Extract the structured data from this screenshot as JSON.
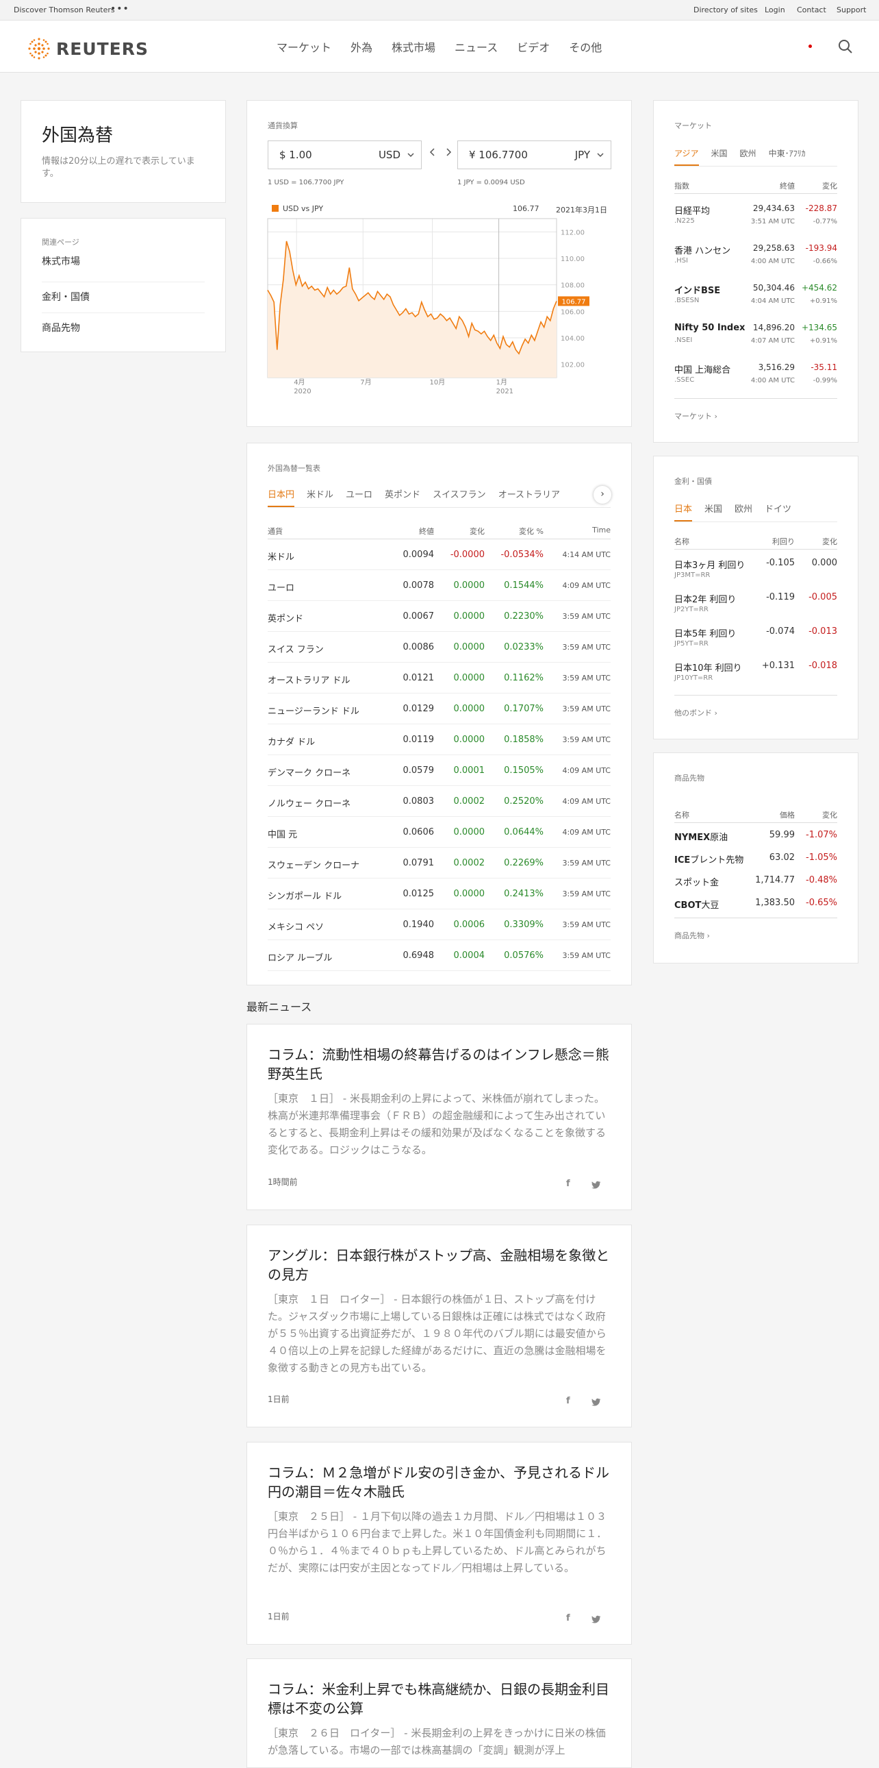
{
  "topbar": {
    "discover": "Discover Thomson Reuters",
    "links": [
      "Directory of sites",
      "Login",
      "Contact",
      "Support"
    ]
  },
  "header": {
    "logo": "REUTERS",
    "nav": [
      "マーケット",
      "外為",
      "株式市場",
      "ニュース",
      "ビデオ",
      "その他"
    ]
  },
  "page": {
    "title": "外国為替",
    "note": "情報は20分以上の遅れで表示しています。"
  },
  "related": {
    "heading": "関連ページ",
    "items": [
      "株式市場",
      "金利・国債",
      "商品先物"
    ]
  },
  "converter": {
    "heading": "通貨換算",
    "from_value": "$ 1.00",
    "from_ccy": "USD",
    "to_value": "¥ 106.7700",
    "to_ccy": "JPY",
    "rate1": "1 USD = 106.7700 JPY",
    "rate2": "1 JPY = 0.0094 USD"
  },
  "chart_data": {
    "type": "line",
    "legend": "USD vs JPY",
    "last_value": "106.77",
    "last_date": "2021年3月1日",
    "badge": "106.77",
    "yticks": [
      "112.00",
      "110.00",
      "108.00",
      "106.00",
      "104.00",
      "102.00"
    ],
    "xticks": [
      {
        "m": "4月",
        "y": "2020"
      },
      {
        "m": "7月",
        "y": ""
      },
      {
        "m": "10月",
        "y": ""
      },
      {
        "m": "1月",
        "y": "2021"
      }
    ],
    "ylim": [
      101,
      113
    ],
    "values": [
      107.6,
      107.2,
      106.7,
      103.1,
      106.5,
      108.4,
      111.3,
      110.5,
      109.1,
      108.0,
      108.7,
      107.9,
      108.2,
      107.7,
      107.9,
      107.6,
      107.7,
      107.4,
      107.1,
      107.8,
      107.3,
      107.6,
      107.3,
      107.5,
      107.8,
      107.9,
      109.3,
      107.7,
      107.3,
      106.8,
      107.0,
      107.2,
      107.4,
      107.1,
      106.9,
      107.5,
      107.2,
      106.9,
      107.3,
      107.1,
      106.5,
      106.1,
      105.7,
      105.9,
      106.2,
      105.8,
      105.9,
      105.6,
      105.8,
      106.7,
      106.1,
      105.6,
      105.8,
      105.4,
      105.5,
      105.8,
      105.6,
      105.3,
      105.5,
      105.1,
      104.7,
      105.6,
      105.3,
      104.8,
      104.1,
      105.1,
      104.6,
      104.5,
      104.3,
      104.5,
      104.1,
      103.8,
      104.2,
      103.6,
      103.2,
      104.1,
      103.5,
      103.3,
      103.7,
      103.1,
      102.8,
      103.4,
      103.9,
      103.6,
      104.2,
      103.8,
      104.5,
      105.2,
      104.8,
      105.6,
      105.3,
      106.2,
      106.77
    ]
  },
  "fx": {
    "heading": "外国為替一覧表",
    "tabs": [
      "日本円",
      "米ドル",
      "ユーロ",
      "英ポンド",
      "スイスフラン",
      "オーストラリア"
    ],
    "cols": [
      "通貨",
      "終値",
      "変化",
      "変化 %",
      "Time"
    ],
    "rows": [
      [
        "米ドル",
        "0.0094",
        "-0.0000",
        "-0.0534%",
        "4:14 AM UTC"
      ],
      [
        "ユーロ",
        "0.0078",
        "0.0000",
        "0.1544%",
        "4:09 AM UTC"
      ],
      [
        "英ポンド",
        "0.0067",
        "0.0000",
        "0.2230%",
        "3:59 AM UTC"
      ],
      [
        "スイス フラン",
        "0.0086",
        "0.0000",
        "0.0233%",
        "3:59 AM UTC"
      ],
      [
        "オーストラリア ドル",
        "0.0121",
        "0.0000",
        "0.1162%",
        "3:59 AM UTC"
      ],
      [
        "ニュージーランド ドル",
        "0.0129",
        "0.0000",
        "0.1707%",
        "3:59 AM UTC"
      ],
      [
        "カナダ ドル",
        "0.0119",
        "0.0000",
        "0.1858%",
        "3:59 AM UTC"
      ],
      [
        "デンマーク クローネ",
        "0.0579",
        "0.0001",
        "0.1505%",
        "4:09 AM UTC"
      ],
      [
        "ノルウェー クローネ",
        "0.0803",
        "0.0002",
        "0.2520%",
        "4:09 AM UTC"
      ],
      [
        "中国 元",
        "0.0606",
        "0.0000",
        "0.0644%",
        "4:09 AM UTC"
      ],
      [
        "スウェーデン クローナ",
        "0.0791",
        "0.0002",
        "0.2269%",
        "3:59 AM UTC"
      ],
      [
        "シンガポール ドル",
        "0.0125",
        "0.0000",
        "0.2413%",
        "3:59 AM UTC"
      ],
      [
        "メキシコ ペソ",
        "0.1940",
        "0.0006",
        "0.3309%",
        "3:59 AM UTC"
      ],
      [
        "ロシア ルーブル",
        "0.6948",
        "0.0004",
        "0.0576%",
        "3:59 AM UTC"
      ]
    ]
  },
  "newsHeading": "最新ニュース",
  "news": [
    {
      "title": "コラム：流動性相場の終幕告げるのはインフレ懸念＝熊野英生氏",
      "body": "［東京　１日］ - 米長期金利の上昇によって、米株価が崩れてしまった。株高が米連邦準備理事会（ＦＲＢ）の超金融緩和によって生み出されているとすると、長期金利上昇はその緩和効果が及ばなくなることを象徴する変化である。ロジックはこうなる。",
      "time": "1時間前"
    },
    {
      "title": "アングル：日本銀行株がストップ高、金融相場を象徴との見方",
      "body": "［東京　１日　ロイター］ - 日本銀行の株価が１日、ストップ高を付けた。ジャスダック市場に上場している日銀株は正確には株式ではなく政府が５５％出資する出資証券だが、１９８０年代のバブル期には最安値から４０倍以上の上昇を記録した経緯があるだけに、直近の急騰は金融相場を象徴する動きとの見方も出ている。",
      "time": "1日前"
    },
    {
      "title": "コラム：Ｍ２急増がドル安の引き金か、予見されるドル円の潮目＝佐々木融氏",
      "body": "［東京　２５日］ - １月下旬以降の過去１カ月間、ドル／円相場は１０３円台半ばから１０６円台まで上昇した。米１０年国債金利も同期間に１．０％から１．４％まで４０ｂｐも上昇しているため、ドル高とみられがちだが、実際には円安が主因となってドル／円相場は上昇している。",
      "time": "1日前"
    },
    {
      "title": "コラム：米金利上昇でも株高継続か、日銀の長期金利目標は不変の公算",
      "body": "［東京　２６日　ロイター］ - 米長期金利の上昇をきっかけに日米の株価が急落している。市場の一部では株高基調の「変調」観測が浮上",
      "time": ""
    }
  ],
  "markets": {
    "heading": "マーケット",
    "tabs": [
      "アジア",
      "米国",
      "欧州",
      "中東･ｱﾌﾘｶ"
    ],
    "cols": [
      "指数",
      "終値",
      "変化"
    ],
    "rows": [
      {
        "name": "日経平均",
        "ric": ".N225",
        "value": "29,434.63",
        "time": "3:51 AM UTC",
        "chg": "-228.87",
        "pct": "-0.77%",
        "up": false,
        "bold": false
      },
      {
        "name": "香港 ハンセン",
        "ric": ".HSI",
        "value": "29,258.63",
        "time": "4:00 AM UTC",
        "chg": "-193.94",
        "pct": "-0.66%",
        "up": false,
        "bold": false
      },
      {
        "name": "インドBSE",
        "ric": ".BSESN",
        "value": "50,304.46",
        "time": "4:04 AM UTC",
        "chg": "+454.62",
        "pct": "+0.91%",
        "up": true,
        "bold": true
      },
      {
        "name": "Nifty 50 Index",
        "ric": ".NSEI",
        "value": "14,896.20",
        "time": "4:07 AM UTC",
        "chg": "+134.65",
        "pct": "+0.91%",
        "up": true,
        "bold": true
      },
      {
        "name": "中国 上海総合",
        "ric": ".SSEC",
        "value": "3,516.29",
        "time": "4:00 AM UTC",
        "chg": "-35.11",
        "pct": "-0.99%",
        "up": false,
        "bold": false
      }
    ],
    "more": "マーケット ›"
  },
  "bonds": {
    "heading": "金利・国債",
    "tabs": [
      "日本",
      "米国",
      "欧州",
      "ドイツ"
    ],
    "cols": [
      "名称",
      "利回り",
      "変化"
    ],
    "rows": [
      {
        "name": "日本3ヶ月 利回り",
        "ric": "JP3MT=RR",
        "yld": "-0.105",
        "chg": "0.000",
        "neg": false
      },
      {
        "name": "日本2年 利回り",
        "ric": "JP2YT=RR",
        "yld": "-0.119",
        "chg": "-0.005",
        "neg": true
      },
      {
        "name": "日本5年 利回り",
        "ric": "JP5YT=RR",
        "yld": "-0.074",
        "chg": "-0.013",
        "neg": true
      },
      {
        "name": "日本10年 利回り",
        "ric": "JP10YT=RR",
        "yld": "+0.131",
        "chg": "-0.018",
        "neg": true
      }
    ],
    "more": "他のボンド ›"
  },
  "commod": {
    "heading": "商品先物",
    "cols": [
      "名称",
      "価格",
      "変化"
    ],
    "rows": [
      {
        "pre": "NYMEX",
        "name": "原油",
        "price": "59.99",
        "chg": "-1.07%"
      },
      {
        "pre": "ICE",
        "name": "ブレント先物",
        "price": "63.02",
        "chg": "-1.05%"
      },
      {
        "pre": "",
        "name": "スポット金",
        "price": "1,714.77",
        "chg": "-0.48%"
      },
      {
        "pre": "CBOT",
        "name": "大豆",
        "price": "1,383.50",
        "chg": "-0.65%"
      }
    ],
    "more": "商品先物 ›"
  },
  "colors": {
    "accent": "#e37a14",
    "neg": "#c41c1c",
    "pos": "#2a8a2a"
  },
  "icons": [
    "search-icon",
    "chevron-left-icon",
    "chevron-right-icon",
    "chevron-down-icon",
    "facebook-icon",
    "twitter-icon"
  ]
}
